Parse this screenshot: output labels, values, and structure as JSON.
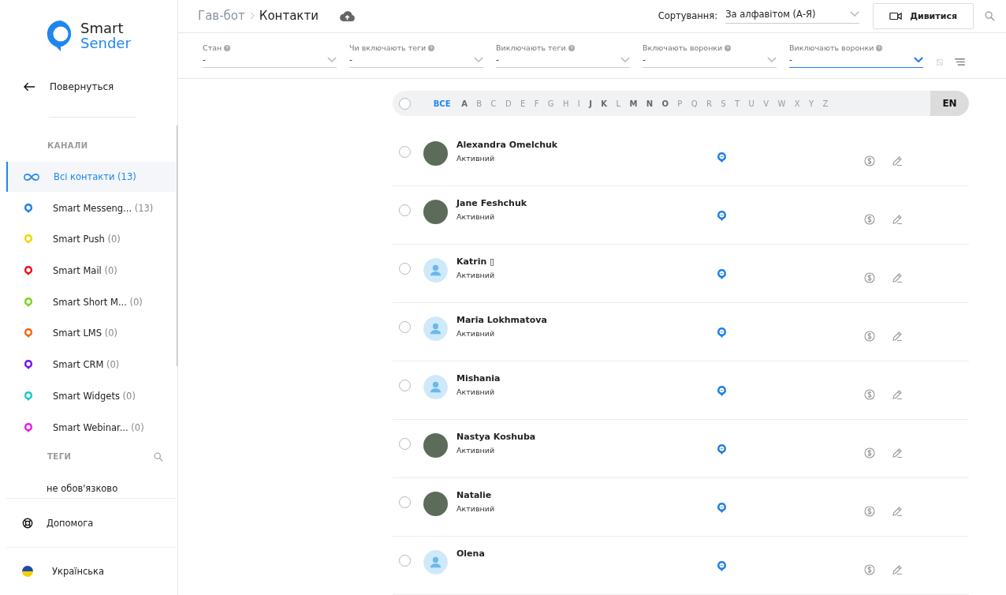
{
  "logo": {
    "line1": "Smart",
    "line2": "Sender"
  },
  "back": "Повернуться",
  "channels_heading": "КАНАЛИ",
  "channels": [
    {
      "kind": "all",
      "name": "Всі контакти",
      "count": "(13)",
      "color": "#2b86f0",
      "selected": true
    },
    {
      "kind": "channel",
      "name": "Smart Messeng...",
      "count": "(13)",
      "color": "#1f7fe8",
      "selected": false
    },
    {
      "kind": "channel",
      "name": "Smart Push",
      "count": "(0)",
      "color": "#f2d600",
      "selected": false
    },
    {
      "kind": "channel",
      "name": "Smart Mail",
      "count": "(0)",
      "color": "#e8171c",
      "selected": false
    },
    {
      "kind": "channel",
      "name": "Smart Short M...",
      "count": "(0)",
      "color": "#7ed321",
      "selected": false
    },
    {
      "kind": "channel",
      "name": "Smart LMS",
      "count": "(0)",
      "color": "#f5650f",
      "selected": false
    },
    {
      "kind": "channel",
      "name": "Smart CRM",
      "count": "(0)",
      "color": "#7a12e8",
      "selected": false
    },
    {
      "kind": "channel",
      "name": "Smart Widgets",
      "count": "(0)",
      "color": "#1ec8c8",
      "selected": false
    },
    {
      "kind": "channel",
      "name": "Smart Webinar...",
      "count": "(0)",
      "color": "#e81ee8",
      "selected": false
    }
  ],
  "tags_heading": "ТЕГИ",
  "tags_placeholder": "не обов'язково",
  "help": "Допомога",
  "language": "Українська",
  "breadcrumb": [
    "Гав-бот",
    "Контакти"
  ],
  "sort": {
    "label": "Сортування:",
    "value": "За алфавітом (А-Я)"
  },
  "watch_button": "Дивитися",
  "filters": [
    {
      "label": "Стан",
      "value": "-",
      "focused": false
    },
    {
      "label": "Чи включають теги",
      "value": "-",
      "focused": false
    },
    {
      "label": "Виключають теги",
      "value": "-",
      "focused": false
    },
    {
      "label": "Включають воронки",
      "value": "-",
      "focused": false
    },
    {
      "label": "Виключають воронки",
      "value": "-",
      "focused": true
    }
  ],
  "alphabet": {
    "select_all_checked": false,
    "letters": [
      {
        "label": "ВСЕ",
        "selected": true,
        "disabled": false
      },
      {
        "label": "A",
        "selected": false,
        "disabled": false
      },
      {
        "label": "B",
        "selected": false,
        "disabled": true
      },
      {
        "label": "C",
        "selected": false,
        "disabled": true
      },
      {
        "label": "D",
        "selected": false,
        "disabled": true
      },
      {
        "label": "E",
        "selected": false,
        "disabled": true
      },
      {
        "label": "F",
        "selected": false,
        "disabled": true
      },
      {
        "label": "G",
        "selected": false,
        "disabled": true
      },
      {
        "label": "H",
        "selected": false,
        "disabled": true
      },
      {
        "label": "I",
        "selected": false,
        "disabled": true
      },
      {
        "label": "J",
        "selected": false,
        "disabled": false
      },
      {
        "label": "K",
        "selected": false,
        "disabled": false
      },
      {
        "label": "L",
        "selected": false,
        "disabled": true
      },
      {
        "label": "M",
        "selected": false,
        "disabled": false
      },
      {
        "label": "N",
        "selected": false,
        "disabled": false
      },
      {
        "label": "O",
        "selected": false,
        "disabled": false
      },
      {
        "label": "P",
        "selected": false,
        "disabled": true
      },
      {
        "label": "Q",
        "selected": false,
        "disabled": true
      },
      {
        "label": "R",
        "selected": false,
        "disabled": true
      },
      {
        "label": "S",
        "selected": false,
        "disabled": true
      },
      {
        "label": "T",
        "selected": false,
        "disabled": true
      },
      {
        "label": "U",
        "selected": false,
        "disabled": true
      },
      {
        "label": "V",
        "selected": false,
        "disabled": true
      },
      {
        "label": "W",
        "selected": false,
        "disabled": true
      },
      {
        "label": "X",
        "selected": false,
        "disabled": true
      },
      {
        "label": "Y",
        "selected": false,
        "disabled": true
      },
      {
        "label": "Z",
        "selected": false,
        "disabled": true
      }
    ],
    "language": "EN"
  },
  "contacts": [
    {
      "name": "Alexandra Omelchuk",
      "status": "Активний",
      "kind": "photo",
      "selected": false
    },
    {
      "name": "Jane Feshchuk",
      "status": "Активний",
      "kind": "photo",
      "selected": false
    },
    {
      "name": "Katrin ▯",
      "status": "Активний",
      "kind": "default",
      "selected": false
    },
    {
      "name": "Maria Lokhmatova",
      "status": "Активний",
      "kind": "default",
      "selected": false
    },
    {
      "name": "Mishania",
      "status": "Активний",
      "kind": "default",
      "selected": false
    },
    {
      "name": "Nastya Koshuba",
      "status": "Активний",
      "kind": "photo",
      "selected": false
    },
    {
      "name": "Natalie",
      "status": "Активний",
      "kind": "photo",
      "selected": false
    },
    {
      "name": "Olena",
      "kind": "default",
      "selected": false
    }
  ]
}
